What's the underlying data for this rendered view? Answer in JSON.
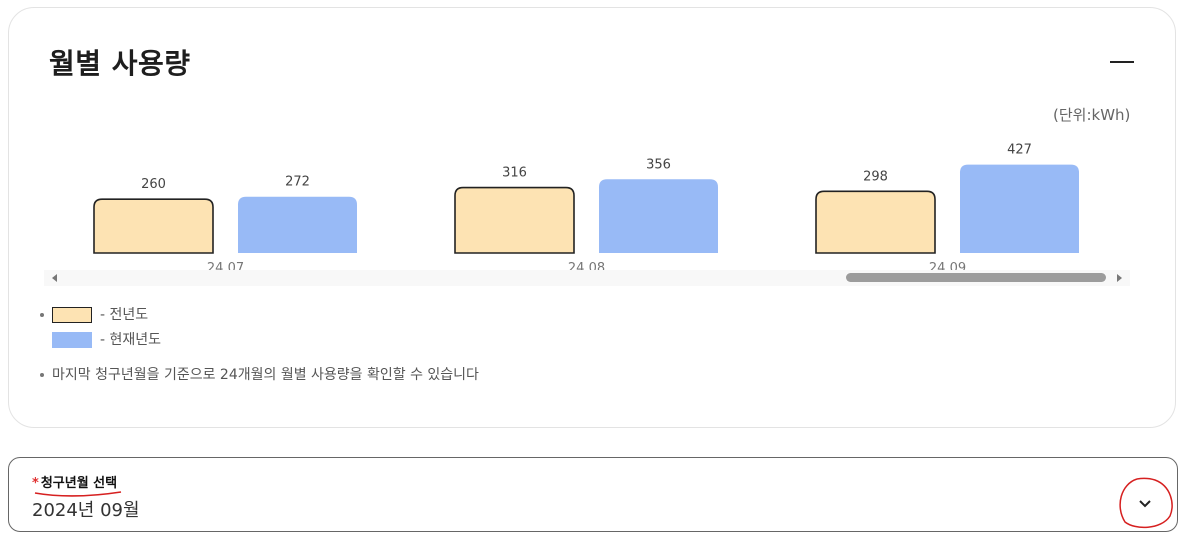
{
  "panel": {
    "title": "월별 사용량",
    "unit": "(단위:kWh)",
    "collapse_icon": "minus-icon"
  },
  "chart_data": {
    "type": "bar",
    "categories": [
      "24.07",
      "24.08",
      "24.09"
    ],
    "series": [
      {
        "name": "전년도",
        "values": [
          260,
          316,
          298
        ],
        "color": "#fde3b3",
        "border": "#222222"
      },
      {
        "name": "현재년도",
        "values": [
          272,
          356,
          427
        ],
        "color": "#98baf6"
      }
    ],
    "ylabel": "",
    "xlabel": "",
    "grid": false
  },
  "legend": {
    "items": [
      {
        "label": "- 전년도"
      },
      {
        "label": "- 현재년도"
      }
    ],
    "note": "마지막 청구년월을 기준으로 24개월의 월별 사용량을 확인할 수 있습니다"
  },
  "select": {
    "required_mark": "*",
    "label": "청구년월 선택",
    "value": "2024년 09월",
    "icon": "chevron-down-icon"
  },
  "colors": {
    "annotation": "#d62020",
    "scroll_thumb": "#9c9c9c"
  }
}
